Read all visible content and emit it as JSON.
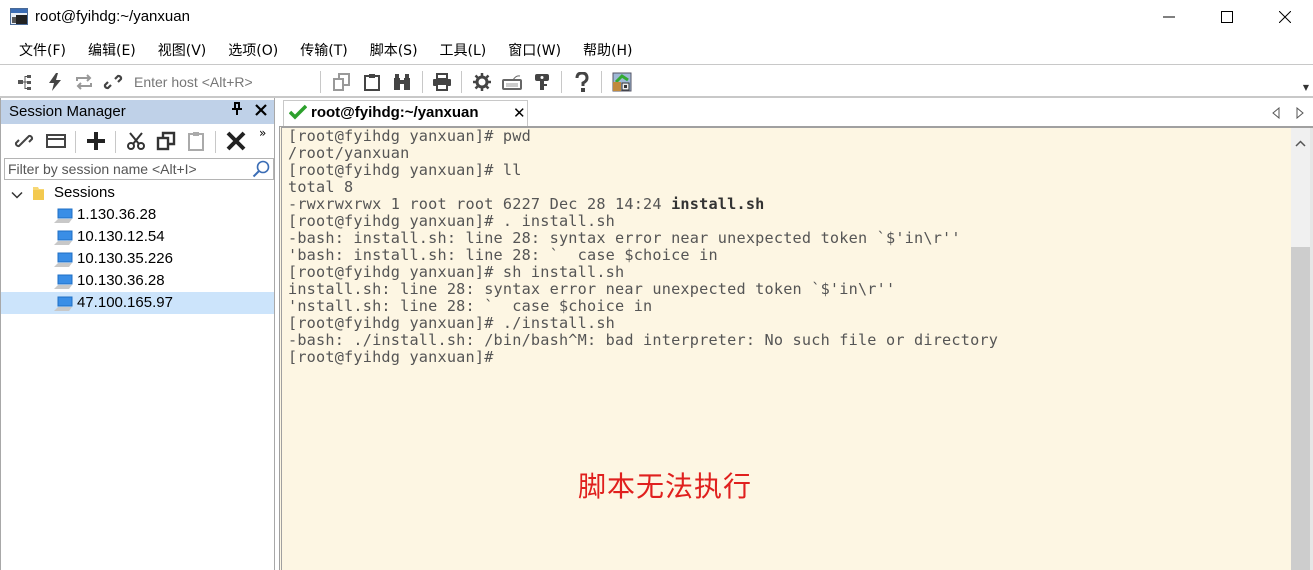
{
  "window": {
    "title": "root@fyihdg:~/yanxuan",
    "minimize_label": "Minimize",
    "maximize_label": "Maximize",
    "close_label": "Close"
  },
  "menubar": [
    {
      "label": "文件(F)"
    },
    {
      "label": "编辑(E)"
    },
    {
      "label": "视图(V)"
    },
    {
      "label": "选项(O)"
    },
    {
      "label": "传输(T)"
    },
    {
      "label": "脚本(S)"
    },
    {
      "label": "工具(L)"
    },
    {
      "label": "窗口(W)"
    },
    {
      "label": "帮助(H)"
    }
  ],
  "toolbar": {
    "host_placeholder": "Enter host <Alt+R>",
    "icons": [
      "connect-tree-icon",
      "quick-connect-icon",
      "reconnect-icon",
      "disconnect-icon",
      "copy-icon",
      "paste-icon",
      "find-icon",
      "print-icon",
      "settings-icon",
      "keymap-icon",
      "key-icon",
      "help-icon",
      "securefx-icon"
    ]
  },
  "session_manager": {
    "title": "Session Manager",
    "pin_glyph": "⨟",
    "close_glyph": "✕",
    "more_glyph": "»",
    "filter_placeholder": "Filter by session name <Alt+I>",
    "root": {
      "label": "Sessions",
      "expanded": true
    },
    "sessions": [
      {
        "label": "1.130.36.28",
        "selected": false
      },
      {
        "label": "10.130.12.54",
        "selected": false
      },
      {
        "label": "10.130.35.226",
        "selected": false
      },
      {
        "label": "10.130.36.28",
        "selected": false
      },
      {
        "label": "47.100.165.97",
        "selected": true
      }
    ]
  },
  "tabs": [
    {
      "label": "root@fyihdg:~/yanxuan",
      "status": "connected",
      "close_glyph": "✕"
    }
  ],
  "terminal": {
    "lines": [
      {
        "text": "[root@fyihdg yanxuan]# pwd"
      },
      {
        "text": "/root/yanxuan"
      },
      {
        "text": "[root@fyihdg yanxuan]# ll"
      },
      {
        "text": "total 8"
      },
      {
        "text": "-rwxrwxrwx 1 root root 6227 Dec 28 14:24 ",
        "bold_suffix": "install.sh"
      },
      {
        "text": "[root@fyihdg yanxuan]# . install.sh"
      },
      {
        "text": "-bash: install.sh: line 28: syntax error near unexpected token `$'in\\r''"
      },
      {
        "text": "'bash: install.sh: line 28: `  case $choice in"
      },
      {
        "text": "[root@fyihdg yanxuan]# sh install.sh"
      },
      {
        "text": "install.sh: line 28: syntax error near unexpected token `$'in\\r''"
      },
      {
        "text": "'nstall.sh: line 28: `  case $choice in"
      },
      {
        "text": "[root@fyihdg yanxuan]# ./install.sh"
      },
      {
        "text": "-bash: ./install.sh: /bin/bash^M: bad interpreter: No such file or directory"
      },
      {
        "text": "[root@fyihdg yanxuan]#"
      }
    ],
    "annotation": "脚本无法执行",
    "background_color": "#fdf6e3",
    "annotation_color": "#e0201e"
  },
  "colors": {
    "session_header_bg": "#bfd1e8",
    "selected_row_bg": "#cce4fb",
    "tab_check": "#2ca02c"
  }
}
